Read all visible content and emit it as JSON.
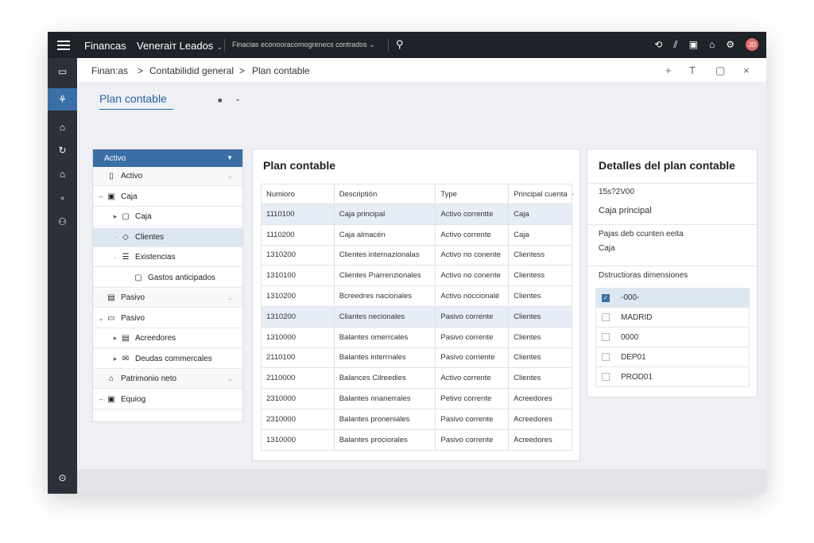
{
  "topbar": {
    "app": "Financas",
    "company": "Veneraiт Leados",
    "path": "Finacias econooracomogrenecs contrados",
    "avatar": "JD"
  },
  "breadcrumb": {
    "items": [
      "Finan:as",
      "Contabilidid general",
      "Plan contable"
    ],
    "sep": ">"
  },
  "page": {
    "title": "Plan contable"
  },
  "tree": {
    "header": "Activo",
    "rows": [
      {
        "label": "Activo",
        "icon": "▯",
        "expander": "",
        "group": true
      },
      {
        "label": "Caja",
        "icon": "▣",
        "expander": "–"
      },
      {
        "label": "Caja",
        "icon": "▢",
        "expander": "▸"
      },
      {
        "label": "Clientes",
        "icon": "◇",
        "expander": "·",
        "selected": true
      },
      {
        "label": "Existencias",
        "icon": "☰",
        "expander": "·"
      },
      {
        "label": "Gastos anticipados",
        "icon": "▢",
        "expander": ""
      },
      {
        "label": "Pasivo",
        "icon": "▤",
        "expander": "",
        "group": true
      },
      {
        "label": "Pasivo",
        "icon": "▭",
        "expander": "⌄"
      },
      {
        "label": "Acreedores",
        "icon": "▤",
        "expander": "▸"
      },
      {
        "label": "Deudas commercales",
        "icon": "✉",
        "expander": "▸"
      },
      {
        "label": "Patrimonio neto",
        "icon": "⌂",
        "expander": "",
        "group": true
      },
      {
        "label": "Equiog",
        "icon": "▣",
        "expander": "–"
      }
    ]
  },
  "grid": {
    "title": "Plan contable",
    "columns": [
      "Numioro",
      "Descriptión",
      "Type",
      "Principal cuenta"
    ],
    "rows": [
      [
        "1110100",
        "Caja principal",
        "Activo correntte",
        "Caja"
      ],
      [
        "1110200",
        "Caja almacén",
        "Activo corrente",
        "Caja"
      ],
      [
        "1310200",
        "Clientes internazionalas",
        "Activo no conente",
        "Clientess"
      ],
      [
        "1310100",
        "Clientes Pıarrenzionales",
        "Activo no conente",
        "Clientess"
      ],
      [
        "1310200",
        "Bcreedres nacionales",
        "Activo noccionalé",
        "Clientes"
      ],
      [
        "1310200",
        "Cliantes necionales",
        "Pasivo corrente",
        "Clientes"
      ],
      [
        "1310000",
        "Balantes omerrcales",
        "Pasivo corrente",
        "Clientes"
      ],
      [
        "2110100",
        "Balantes interrnales",
        "Pasivo corriente",
        "Clientes"
      ],
      [
        "2110000",
        "Balances Cilreedies",
        "Activo corrente",
        "Clientes"
      ],
      [
        "2310000",
        "Balantes nnanerrales",
        "Petivo corrente",
        "Acreedores"
      ],
      [
        "2310000",
        "Balantes proneniales",
        "Pasivo corrente",
        "Acreedores"
      ],
      [
        "1310000",
        "Balantes prociorales",
        "Pasivo corrente",
        "Acreedores"
      ]
    ]
  },
  "details": {
    "title": "Detalles del plan contable",
    "code": "15s?2V00",
    "name": "Caja principal",
    "field_label": "Pajas deb ccunten eeita",
    "field_value": "Caja",
    "dim_title": "Dstructioras dimensiones",
    "dims": [
      {
        "label": "-000-",
        "checked": true
      },
      {
        "label": "MADRID",
        "checked": false
      },
      {
        "label": "0000",
        "checked": false
      },
      {
        "label": "DEP01",
        "checked": false
      },
      {
        "label": "PROD01",
        "checked": false
      }
    ]
  },
  "colors": {
    "accent": "#3a6ea5",
    "topbar": "#1f2229",
    "rail": "#2b3039",
    "selected_row": "#dde7f2"
  }
}
